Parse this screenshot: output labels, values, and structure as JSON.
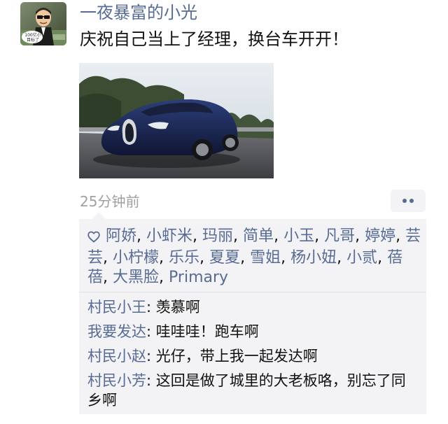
{
  "post": {
    "author": "一夜暴富的小光",
    "text": "庆祝自己当上了经理，换台车开开！",
    "avatar_caption": "100亿小目标了",
    "time": "25分钟前"
  },
  "likes": [
    {
      "name": "阿娇"
    },
    {
      "name": "小虾米"
    },
    {
      "name": "玛丽"
    },
    {
      "name": "简单"
    },
    {
      "name": "小玉"
    },
    {
      "name": "凡哥"
    },
    {
      "name": "婷婷"
    },
    {
      "name": "芸芸"
    },
    {
      "name": "小柠檬"
    },
    {
      "name": "乐乐"
    },
    {
      "name": "夏夏"
    },
    {
      "name": "雪姐"
    },
    {
      "name": "杨小妞"
    },
    {
      "name": "小贰"
    },
    {
      "name": "蓓蓓"
    },
    {
      "name": "大黑脸"
    },
    {
      "name": "Primary"
    }
  ],
  "comments": [
    {
      "author": "村民小王",
      "text": "羡慕啊"
    },
    {
      "author": "我要发达",
      "text": "哇哇哇！跑车啊"
    },
    {
      "author": "村民小赵",
      "text": "光仔，带上我一起发达啊"
    },
    {
      "author": "村民小芳",
      "text": "这回是做了城里的大老板咯，别忘了同乡啊"
    }
  ],
  "colors": {
    "link": "#576b95",
    "time": "#a0a0a0",
    "panel": "#f3f3f5",
    "text": "#111111"
  },
  "icons": {
    "like": "heart-outline-icon",
    "more": "more-dots-icon"
  }
}
